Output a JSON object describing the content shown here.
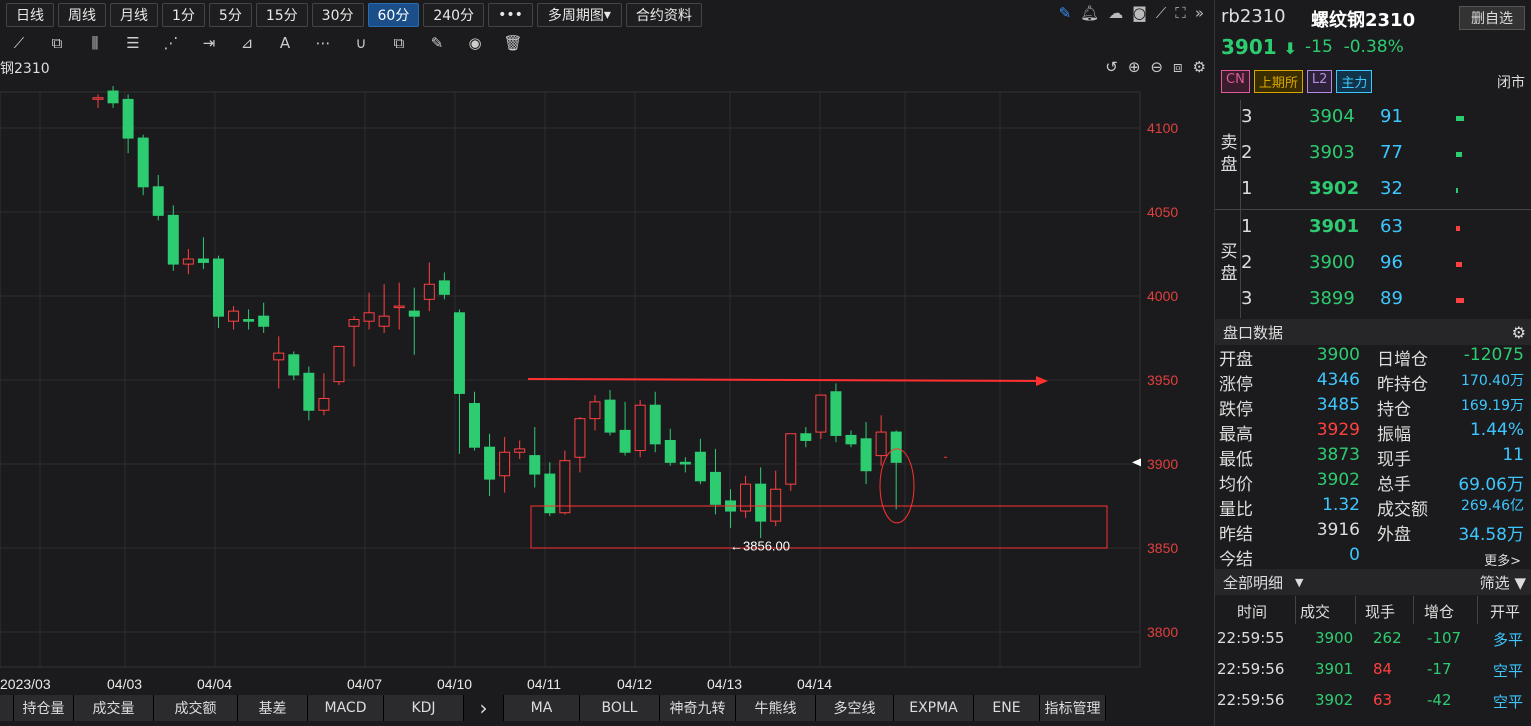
{
  "toolbar": {
    "periods": [
      "日线",
      "周线",
      "月线",
      "1分",
      "5分",
      "15分",
      "30分",
      "60分",
      "240分"
    ],
    "active_period": "60分",
    "more_label": "•••",
    "multi_period": "多周期图",
    "contract_info": "合约资料"
  },
  "chart": {
    "symbol_label": "钢2310",
    "low_annotation": "←3856.00"
  },
  "bottom_tabs": [
    "持仓量",
    "成交量",
    "成交额",
    "基差",
    "MACD",
    "KDJ",
    "MA",
    "BOLL",
    "神奇九转",
    "牛熊线",
    "多空线",
    "EXPMA",
    "ENE",
    "指标管理"
  ],
  "quote": {
    "code": "rb2310",
    "name": "螺纹钢2310",
    "delete_label": "删自选",
    "price": "3901",
    "arrow": "⬇",
    "change": "-15",
    "change_pct": "-0.38%",
    "tags": [
      "CN",
      "上期所",
      "L2",
      "主力"
    ],
    "status": "闭市"
  },
  "orderbook": {
    "sell_label": "卖盘",
    "buy_label": "买盘",
    "asks": [
      {
        "level": "3",
        "price": "3904",
        "vol": "91"
      },
      {
        "level": "2",
        "price": "3903",
        "vol": "77"
      },
      {
        "level": "1",
        "price": "3902",
        "vol": "32"
      }
    ],
    "bids": [
      {
        "level": "1",
        "price": "3901",
        "vol": "63"
      },
      {
        "level": "2",
        "price": "3900",
        "vol": "96"
      },
      {
        "level": "3",
        "price": "3899",
        "vol": "89"
      }
    ]
  },
  "stats": {
    "title": "盘口数据",
    "rows": [
      {
        "l": "开盘",
        "v": "3900",
        "vc": "#2ecc71",
        "l2": "日增仓",
        "v2": "-12075",
        "v2c": "#2ecc71"
      },
      {
        "l": "涨停",
        "v": "4346",
        "vc": "#3ec7ff",
        "l2": "昨持仓",
        "v2": "170.40万",
        "v2c": "#3ec7ff"
      },
      {
        "l": "跌停",
        "v": "3485",
        "vc": "#3ec7ff",
        "l2": "持仓",
        "v2": "169.19万",
        "v2c": "#3ec7ff"
      },
      {
        "l": "最高",
        "v": "3929",
        "vc": "#ff4040",
        "l2": "振幅",
        "v2": "1.44%",
        "v2c": "#3ec7ff"
      },
      {
        "l": "最低",
        "v": "3873",
        "vc": "#2ecc71",
        "l2": "现手",
        "v2": "11",
        "v2c": "#3ec7ff"
      },
      {
        "l": "均价",
        "v": "3902",
        "vc": "#2ecc71",
        "l2": "总手",
        "v2": "69.06万",
        "v2c": "#3ec7ff"
      },
      {
        "l": "量比",
        "v": "1.32",
        "vc": "#3ec7ff",
        "l2": "成交额",
        "v2": "269.46亿",
        "v2c": "#3ec7ff"
      },
      {
        "l": "昨结",
        "v": "3916",
        "vc": "#dddddd",
        "l2": "外盘",
        "v2": "34.58万",
        "v2c": "#3ec7ff"
      },
      {
        "l": "今结",
        "v": "0",
        "vc": "#3ec7ff",
        "l2": "",
        "v2": "",
        "v2c": "#3ec7ff"
      }
    ],
    "more": "更多>"
  },
  "trades": {
    "title": "全部明细",
    "filter": "筛选",
    "headers": [
      "时间",
      "成交",
      "现手",
      "增仓",
      "开平"
    ],
    "rows": [
      {
        "t": "22:59:55",
        "p": "3900",
        "q": "262",
        "d": "-107",
        "k": "多平",
        "pc": "#2ecc71",
        "qc": "#2ecc71",
        "kc": "#3ec7ff"
      },
      {
        "t": "22:59:56",
        "p": "3901",
        "q": "84",
        "d": "-17",
        "k": "空平",
        "pc": "#2ecc71",
        "qc": "#ff4040",
        "kc": "#3ec7ff"
      },
      {
        "t": "22:59:56",
        "p": "3902",
        "q": "63",
        "d": "-42",
        "k": "空平",
        "pc": "#2ecc71",
        "qc": "#ff4040",
        "kc": "#3ec7ff"
      }
    ]
  },
  "chart_data": {
    "type": "candlestick",
    "y_ticks": [
      4100,
      4050,
      4000,
      3950,
      3900,
      3850,
      3800
    ],
    "x_labels": [
      "2023/03",
      "04/03",
      "04/04",
      "04/07",
      "04/10",
      "04/11",
      "04/12",
      "04/13",
      "04/14"
    ],
    "candles": [
      [
        4118,
        4120,
        4112,
        4118
      ],
      [
        4122,
        4125,
        4112,
        4115
      ],
      [
        4117,
        4120,
        4085,
        4094
      ],
      [
        4094,
        4096,
        4060,
        4065
      ],
      [
        4065,
        4072,
        4045,
        4048
      ],
      [
        4048,
        4054,
        4015,
        4019
      ],
      [
        4019,
        4028,
        4013,
        4022
      ],
      [
        4022,
        4035,
        4016,
        4020
      ],
      [
        4022,
        4024,
        3981,
        3988
      ],
      [
        3985,
        3994,
        3980,
        3991
      ],
      [
        3986,
        3992,
        3980,
        3985
      ],
      [
        3988,
        3996,
        3978,
        3982
      ],
      [
        3962,
        3976,
        3945,
        3966
      ],
      [
        3965,
        3967,
        3950,
        3953
      ],
      [
        3954,
        3958,
        3926,
        3932
      ],
      [
        3932,
        3954,
        3929,
        3939
      ],
      [
        3949,
        3970,
        3947,
        3970
      ],
      [
        3982,
        3988,
        3958,
        3986
      ],
      [
        3985,
        4002,
        3980,
        3990
      ],
      [
        3982,
        4007,
        3978,
        3988
      ],
      [
        3994,
        4008,
        3980,
        3994
      ],
      [
        3991,
        4005,
        3965,
        3988
      ],
      [
        3998,
        4020,
        3991,
        4007
      ],
      [
        4009,
        4014,
        3998,
        4001
      ],
      [
        3990,
        3992,
        3906,
        3942
      ],
      [
        3936,
        3943,
        3908,
        3910
      ],
      [
        3910,
        3918,
        3881,
        3891
      ],
      [
        3893,
        3916,
        3883,
        3907
      ],
      [
        3907,
        3914,
        3903,
        3909
      ],
      [
        3905,
        3922,
        3886,
        3894
      ],
      [
        3894,
        3901,
        3869,
        3871
      ],
      [
        3871,
        3908,
        3870,
        3902
      ],
      [
        3904,
        3928,
        3895,
        3927
      ],
      [
        3927,
        3941,
        3920,
        3937
      ],
      [
        3938,
        3944,
        3917,
        3919
      ],
      [
        3920,
        3937,
        3905,
        3907
      ],
      [
        3908,
        3938,
        3904,
        3935
      ],
      [
        3935,
        3943,
        3907,
        3912
      ],
      [
        3914,
        3921,
        3899,
        3901
      ],
      [
        3901,
        3904,
        3895,
        3900
      ],
      [
        3907,
        3915,
        3888,
        3890
      ],
      [
        3895,
        3909,
        3870,
        3876
      ],
      [
        3878,
        3885,
        3862,
        3872
      ],
      [
        3872,
        3893,
        3868,
        3888
      ],
      [
        3888,
        3898,
        3856,
        3866
      ],
      [
        3866,
        3896,
        3863,
        3885
      ],
      [
        3888,
        3916,
        3884,
        3918
      ],
      [
        3918,
        3922,
        3910,
        3914
      ],
      [
        3919,
        3941,
        3915,
        3941
      ],
      [
        3943,
        3948,
        3913,
        3917
      ],
      [
        3917,
        3920,
        3910,
        3912
      ],
      [
        3915,
        3925,
        3888,
        3896
      ],
      [
        3905,
        3929,
        3899,
        3919
      ],
      [
        3919,
        3920,
        3873,
        3901
      ]
    ],
    "horizontal_arrow": 3950,
    "box": {
      "top": 3875,
      "bottom": 3850
    },
    "low_label_value": 3856
  }
}
